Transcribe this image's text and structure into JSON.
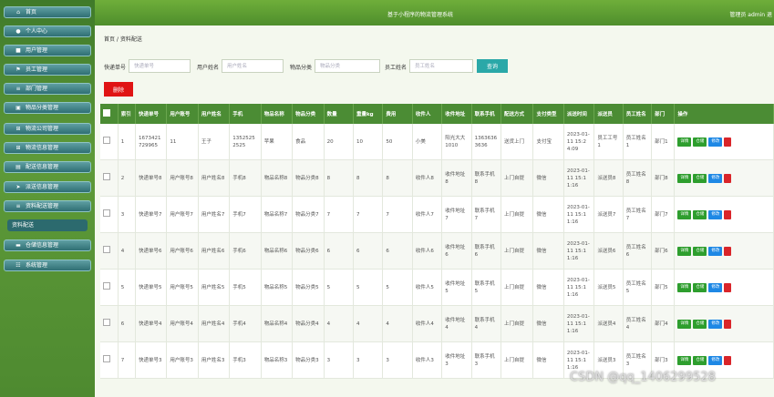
{
  "header": {
    "title": "基于小程序的物流管理系统",
    "user": "管理员 admin 退"
  },
  "breadcrumb": "首页 / 资料配送",
  "sidebar": {
    "items": [
      {
        "label": "首页",
        "icon": "home-icon",
        "glyph": "⌂"
      },
      {
        "label": "个人中心",
        "icon": "user-icon",
        "glyph": "●"
      },
      {
        "label": "用户管理",
        "icon": "users-icon",
        "glyph": "■"
      },
      {
        "label": "员工管理",
        "icon": "flag-icon",
        "glyph": "⚑"
      },
      {
        "label": "部门管理",
        "icon": "list-icon",
        "glyph": "≡"
      },
      {
        "label": "物品分类管理",
        "icon": "box-icon",
        "glyph": "▣"
      },
      {
        "label": "物流公司管理",
        "icon": "grid-icon",
        "glyph": "⊞"
      },
      {
        "label": "物流信息管理",
        "icon": "grid-icon",
        "glyph": "⊞"
      },
      {
        "label": "配送信息管理",
        "icon": "truck-icon",
        "glyph": "▤"
      },
      {
        "label": "派送信息管理",
        "icon": "send-icon",
        "glyph": "➤"
      },
      {
        "label": "资料配送管理",
        "icon": "list-icon",
        "glyph": "≡"
      },
      {
        "label": "资料配送",
        "icon": "",
        "glyph": ""
      },
      {
        "label": "仓储信息管理",
        "icon": "warehouse-icon",
        "glyph": "▬"
      },
      {
        "label": "系统管理",
        "icon": "settings-icon",
        "glyph": "☷"
      }
    ]
  },
  "search": {
    "f1_label": "快递单号",
    "f1_placeholder": "快递单号",
    "f2_label": "用户姓名",
    "f2_placeholder": "用户姓名",
    "f3_label": "物品分类",
    "f3_placeholder": "物品分类",
    "f4_label": "员工姓名",
    "f4_placeholder": "员工姓名",
    "button": "查询"
  },
  "toolbar": {
    "delete_label": "删除"
  },
  "table": {
    "headers": [
      "索引",
      "快递单号",
      "用户账号",
      "用户姓名",
      "手机",
      "物品名称",
      "物品分类",
      "数量",
      "重量kg",
      "费用",
      "收件人",
      "收件地址",
      "联系手机",
      "配送方式",
      "支付类型",
      "派送时间",
      "派送员",
      "员工姓名",
      "部门",
      "操作"
    ],
    "ops": {
      "detail": "详情",
      "ops2": "仓储",
      "edit": "修改"
    },
    "rows": [
      [
        "1",
        "1673421729965",
        "11",
        "王子",
        "13525252525",
        "苹果",
        "食品",
        "20",
        "10",
        "50",
        "小美",
        "阳光大大1010",
        "13636363636",
        "送货上门",
        "支付宝",
        "2023-01-11 15:24:09",
        "员工工号1",
        "员工姓名1",
        "部门1"
      ],
      [
        "2",
        "快递单号8",
        "用户账号8",
        "用户姓名8",
        "手机8",
        "物品名称8",
        "物品分类8",
        "8",
        "8",
        "8",
        "收件人8",
        "收件地址8",
        "联系手机8",
        "上门自提",
        "微信",
        "2023-01-11 15:11:16",
        "派送员8",
        "员工姓名8",
        "部门8"
      ],
      [
        "3",
        "快递单号7",
        "用户账号7",
        "用户姓名7",
        "手机7",
        "物品名称7",
        "物品分类7",
        "7",
        "7",
        "7",
        "收件人7",
        "收件地址7",
        "联系手机7",
        "上门自提",
        "微信",
        "2023-01-11 15:11:16",
        "派送员7",
        "员工姓名7",
        "部门7"
      ],
      [
        "4",
        "快递单号6",
        "用户账号6",
        "用户姓名6",
        "手机6",
        "物品名称6",
        "物品分类6",
        "6",
        "6",
        "6",
        "收件人6",
        "收件地址6",
        "联系手机6",
        "上门自提",
        "微信",
        "2023-01-11 15:11:16",
        "派送员6",
        "员工姓名6",
        "部门6"
      ],
      [
        "5",
        "快递单号5",
        "用户账号5",
        "用户姓名5",
        "手机5",
        "物品名称5",
        "物品分类5",
        "5",
        "5",
        "5",
        "收件人5",
        "收件地址5",
        "联系手机5",
        "上门自提",
        "微信",
        "2023-01-11 15:11:16",
        "派送员5",
        "员工姓名5",
        "部门5"
      ],
      [
        "6",
        "快递单号4",
        "用户账号4",
        "用户姓名4",
        "手机4",
        "物品名称4",
        "物品分类4",
        "4",
        "4",
        "4",
        "收件人4",
        "收件地址4",
        "联系手机4",
        "上门自提",
        "微信",
        "2023-01-11 15:11:16",
        "派送员4",
        "员工姓名4",
        "部门4"
      ],
      [
        "7",
        "快递单号3",
        "用户账号3",
        "用户姓名3",
        "手机3",
        "物品名称3",
        "物品分类3",
        "3",
        "3",
        "3",
        "收件人3",
        "收件地址3",
        "联系手机3",
        "上门自提",
        "微信",
        "2023-01-11 15:11:16",
        "派送员3",
        "员工姓名3",
        "部门3"
      ]
    ]
  },
  "watermark": "CSDN @qq_1406299528"
}
